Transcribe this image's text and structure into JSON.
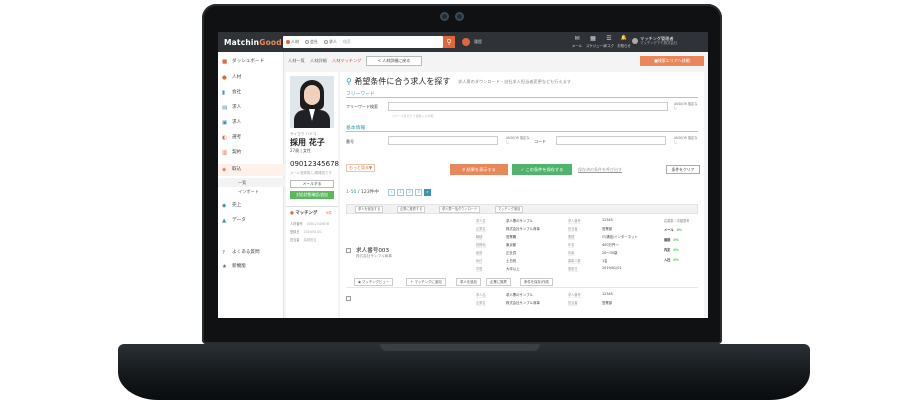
{
  "topbar": {
    "logo_main": "Matchin",
    "logo_accent": "Good",
    "radio_options": [
      "人材",
      "会社",
      "求人"
    ],
    "search_placeholder": "検索",
    "history_label": "履歴",
    "icons": [
      {
        "name": "mail-icon",
        "glyph": "✉",
        "label": "メール"
      },
      {
        "name": "schedule-icon",
        "glyph": "▦",
        "label": "スケジュール"
      },
      {
        "name": "task-icon",
        "glyph": "☰",
        "label": "タスク"
      },
      {
        "name": "notification-icon",
        "glyph": "🔔",
        "label": "お知らせ"
      }
    ],
    "user_name": "マッチング管理者",
    "user_company": "マッチングデモ株式会社"
  },
  "sidebar": {
    "items": [
      {
        "label": "ダッシュボード",
        "icon": "dashboard-icon",
        "glyph": "■",
        "color": "#e0663b"
      },
      {
        "label": "人材",
        "icon": "person-icon",
        "glyph": "●",
        "color": "#e0663b"
      },
      {
        "label": "会社",
        "icon": "company-icon",
        "glyph": "▮",
        "color": "#3e92b8"
      },
      {
        "label": "求人",
        "icon": "job-icon",
        "glyph": "▤",
        "color": "#3e92b8"
      },
      {
        "label": "求人",
        "icon": "job-list-icon",
        "glyph": "▣",
        "color": "#3e92b8"
      },
      {
        "label": "選考",
        "icon": "selection-icon",
        "glyph": "◐",
        "color": "#e0663b"
      },
      {
        "label": "契約",
        "icon": "contract-icon",
        "glyph": "▥",
        "color": "#e0663b"
      },
      {
        "label": "取込",
        "icon": "import-icon",
        "glyph": "◈",
        "color": "#e0663b"
      }
    ],
    "sub_items": [
      "一覧",
      "インポート"
    ],
    "items_after": [
      {
        "label": "売上",
        "icon": "sales-icon",
        "glyph": "◆",
        "color": "#3e92b8"
      },
      {
        "label": "データ",
        "icon": "data-icon",
        "glyph": "▲",
        "color": "#3e92b8"
      }
    ],
    "bottom_items": [
      {
        "label": "よくある質問",
        "icon": "faq-icon",
        "glyph": "?"
      },
      {
        "label": "新機能",
        "icon": "new-feature-icon",
        "glyph": "★"
      }
    ]
  },
  "breadcrumb": {
    "items": [
      "人材一覧",
      "人材詳細",
      "人材マッチング"
    ],
    "back_button": "< 人材詳細に戻る",
    "right_button": "■検索エリアへ移動"
  },
  "profile": {
    "kana": "サイヨウ ハナコ",
    "name": "採用 花子",
    "meta": "27歳 | 女性",
    "phone": "09012345678",
    "email": "メール登録無し/要確認です",
    "mail_button": "メールする",
    "green_button": "対応状態確認/追加",
    "matching_title": "マッチング",
    "matching_count": "0件",
    "matching_rows": [
      {
        "label": "人材番号",
        "value": "00012345678"
      },
      {
        "label": "登録日",
        "value": "2019/01/01"
      },
      {
        "label": "担当者",
        "value": "採用担当"
      }
    ]
  },
  "main": {
    "title": "希望条件に合う求人を探す",
    "note": "求人票のダウンロード・自社求人担当者変更なども行えます",
    "sec_freeword": "フリーワード",
    "freeword_label": "フリーワード検索",
    "freeword_hint": "スペース区切りで複数入力可能",
    "freeword_select": "AND/OR 指定なし",
    "sec_basic": "基本情報",
    "field1_label": "番号",
    "field1_select": "AND/OR 指定なし",
    "field2_label": "コード",
    "field2_select": "AND/OR 指定なし",
    "more_link": "もっと見る▼",
    "btn_show": "結果を表示する",
    "btn_save": "この条件を保存する",
    "link_saved": "保存済の条件を呼び出す",
    "btn_clear": "条件をクリア",
    "count_range": "1-50",
    "count_total": "/ 123件中",
    "pages": [
      "«",
      "1",
      "2",
      "3",
      "»"
    ],
    "action_buttons": [
      "求人を追加する",
      "企業に推薦する",
      "求人票一括ダウンロード",
      "マッチング追加"
    ]
  },
  "jobs": [
    {
      "title": "求人番号003",
      "company": "株式会社サンプル商事",
      "grid": [
        [
          "求人名",
          "求人票のサンプル",
          "求人番号",
          "12345"
        ],
        [
          "企業名",
          "株式会社サンプル商事",
          "担当者",
          "営業部"
        ],
        [
          "職種",
          "営業職",
          "業種",
          "IT/通信/インターネット"
        ],
        [
          "勤務地",
          "東京都",
          "年収",
          "400万円〜"
        ],
        [
          "雇用",
          "正社員",
          "年齢",
          "20〜35歳"
        ],
        [
          "休日",
          "土日祝",
          "募集人数",
          "1名"
        ],
        [
          "学歴",
          "大卒以上",
          "更新日",
          "2019/01/01"
        ]
      ],
      "side": [
        {
          "label": "応募数 / 書類選考",
          "pct": ""
        },
        {
          "label": "メール",
          "pct": "0%"
        },
        {
          "label": "面接",
          "pct": "0%"
        },
        {
          "label": "内定",
          "pct": "0%"
        },
        {
          "label": "入社",
          "pct": "0%"
        }
      ],
      "actions": [
        "マッチングビュー",
        "マッチングに追加",
        "求人を追加",
        "企業に推薦",
        "条件を保存/作成"
      ]
    }
  ],
  "job2_preview": {
    "grid": [
      [
        "求人名",
        "求人票のサンプル",
        "求人番号",
        "12345"
      ],
      [
        "企業名",
        "株式会社サンプル商事",
        "担当者",
        "営業部"
      ]
    ]
  },
  "colors": {
    "accent": "#e0663b",
    "teal": "#2aa0b8",
    "green": "#4fb36b",
    "topbar": "#2f3337"
  }
}
